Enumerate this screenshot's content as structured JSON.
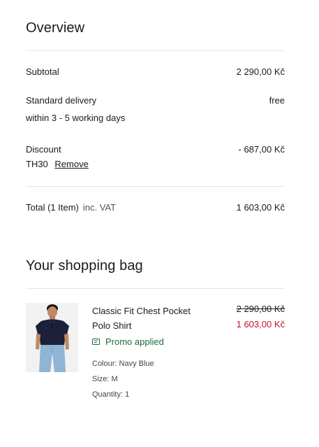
{
  "overview": {
    "title": "Overview",
    "subtotal": {
      "label": "Subtotal",
      "value": "2 290,00 Kč"
    },
    "delivery": {
      "label": "Standard delivery",
      "value": "free",
      "note": "within 3 - 5 working days"
    },
    "discount": {
      "label": "Discount",
      "value": "- 687,00 Kč",
      "code": "TH30",
      "remove_label": "Remove"
    },
    "total": {
      "label": "Total (1 Item)",
      "suffix": "inc. VAT",
      "value": "1 603,00 Kč"
    }
  },
  "bag": {
    "title": "Your shopping bag",
    "items": [
      {
        "name": "Classic Fit Chest Pocket Polo Shirt",
        "original_price": "2 290,00 Kč",
        "price": "1 603,00 Kč",
        "promo": "Promo applied",
        "promo_icon": "tag-icon",
        "colour": "Colour: Navy Blue",
        "size": "Size: M",
        "quantity": "Quantity: 1"
      }
    ]
  },
  "colors": {
    "sale_price": "#c8102e",
    "promo": "#1d6b3a",
    "divider": "#e5e5e5"
  }
}
